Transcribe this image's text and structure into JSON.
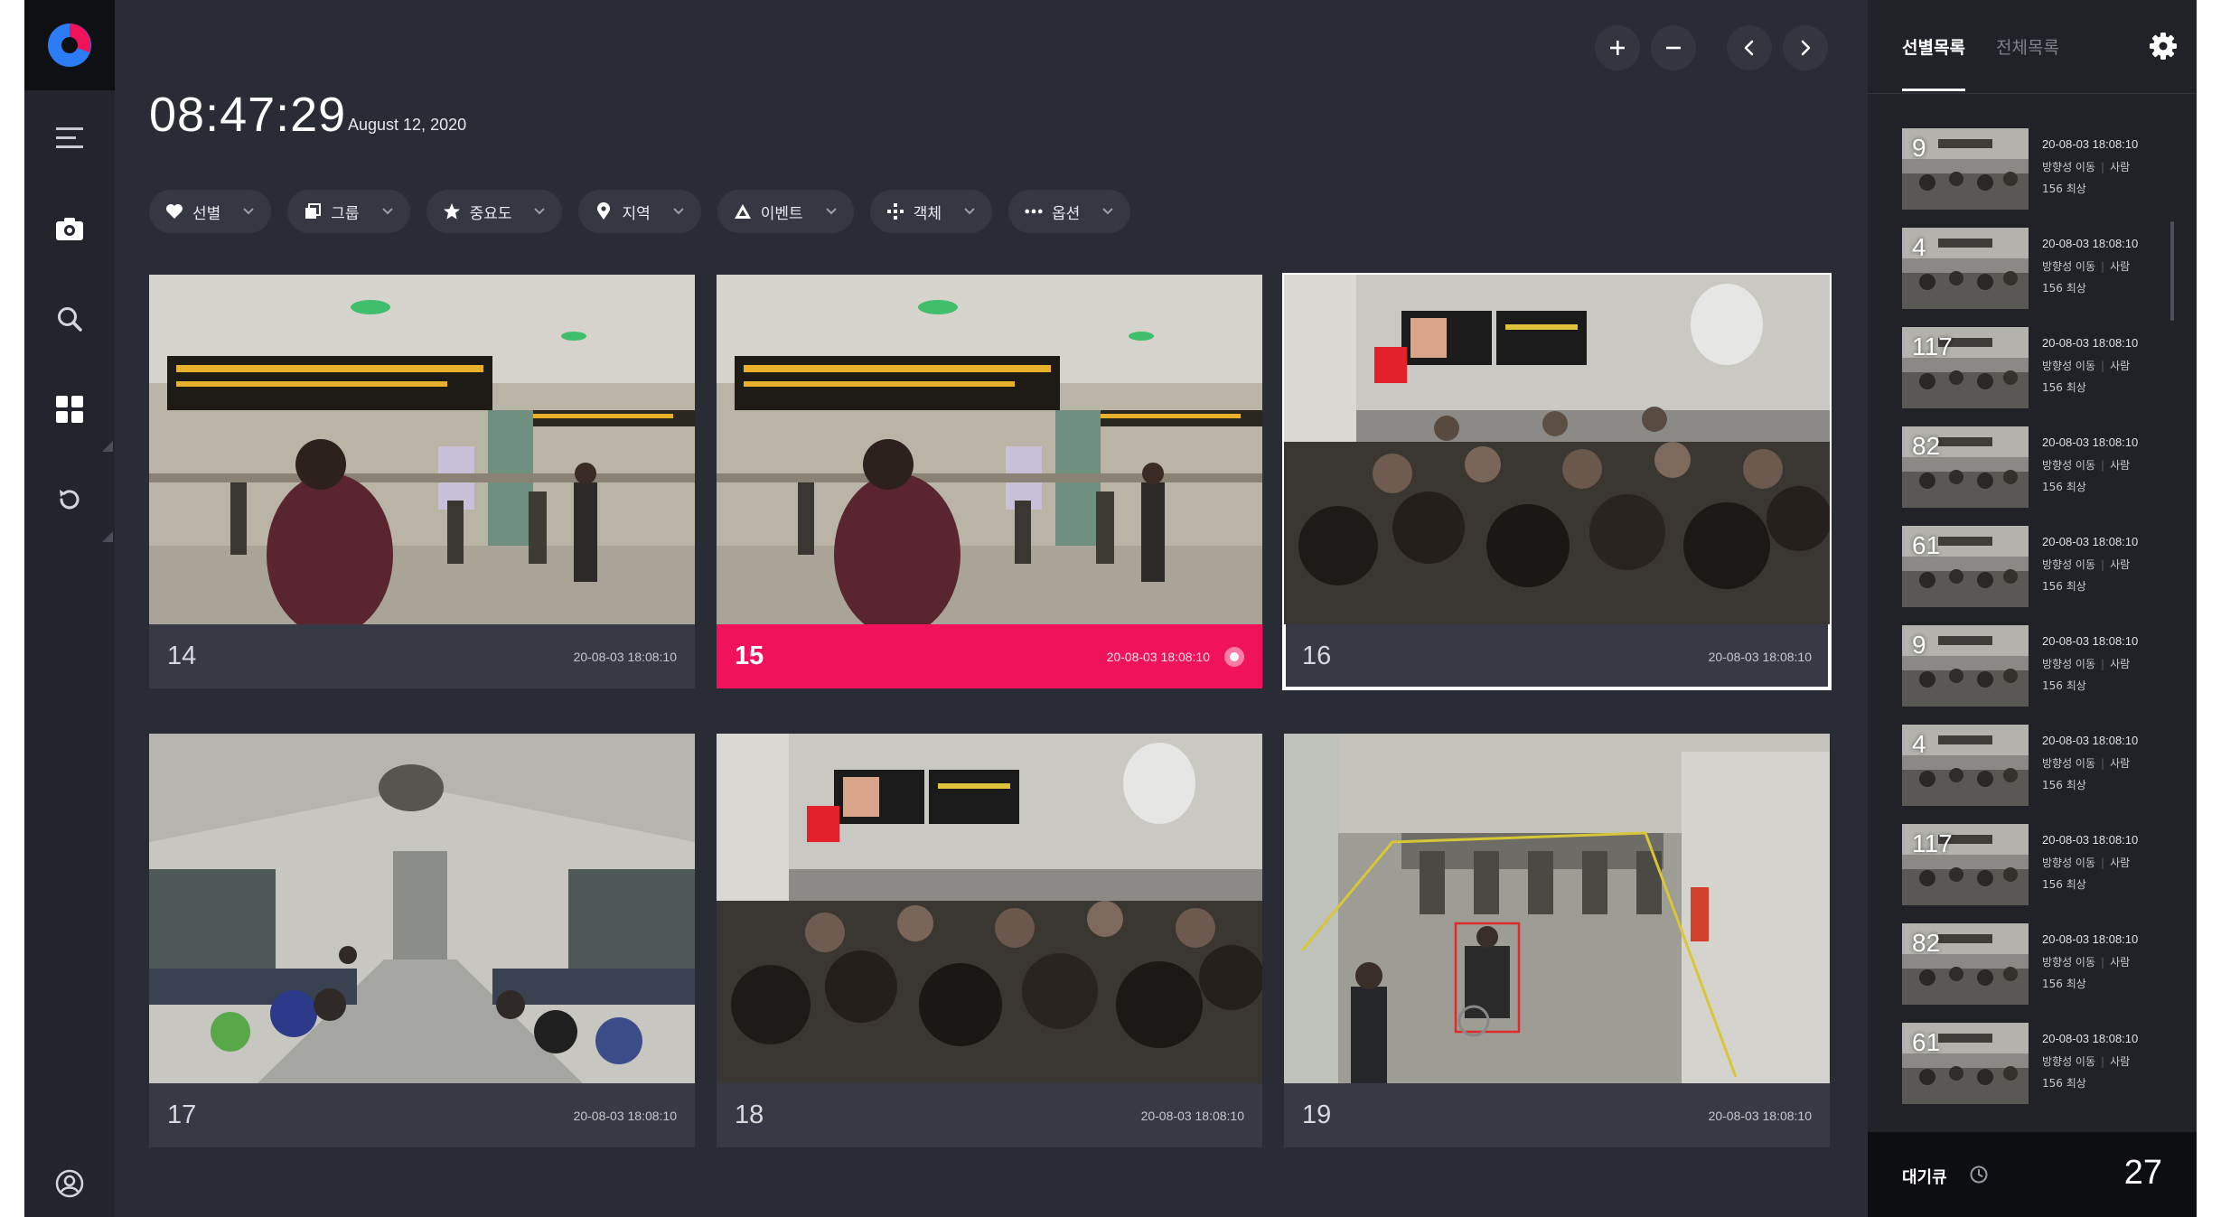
{
  "clock": {
    "time": "08:47:29",
    "date": "August 12, 2020"
  },
  "toolbar": {
    "zoom_in": "plus-icon",
    "zoom_out": "minus-icon",
    "prev": "chevron-left-icon",
    "next": "chevron-right-icon"
  },
  "filters": [
    {
      "label": "선별",
      "icon": "heart-icon"
    },
    {
      "label": "그룹",
      "icon": "stack-icon"
    },
    {
      "label": "중요도",
      "icon": "star-icon"
    },
    {
      "label": "지역",
      "icon": "pin-icon"
    },
    {
      "label": "이벤트",
      "icon": "warning-icon"
    },
    {
      "label": "객체",
      "icon": "object-icon"
    },
    {
      "label": "옵션",
      "icon": "dots-icon"
    }
  ],
  "cameras": [
    {
      "number": "14",
      "timestamp": "20-08-03 18:08:10",
      "state": "normal"
    },
    {
      "number": "15",
      "timestamp": "20-08-03 18:08:10",
      "state": "alert"
    },
    {
      "number": "16",
      "timestamp": "20-08-03 18:08:10",
      "state": "selected"
    },
    {
      "number": "17",
      "timestamp": "20-08-03 18:08:10",
      "state": "normal"
    },
    {
      "number": "18",
      "timestamp": "20-08-03 18:08:10",
      "state": "normal"
    },
    {
      "number": "19",
      "timestamp": "20-08-03 18:08:10",
      "state": "normal"
    }
  ],
  "panel": {
    "tab_selected": "선별목록",
    "tab_all": "전체목록",
    "events": [
      {
        "number": "9",
        "time": "20-08-03 18:08:10",
        "type": "방향성 이동",
        "object": "사람",
        "level": "156 최상"
      },
      {
        "number": "4",
        "time": "20-08-03 18:08:10",
        "type": "방향성 이동",
        "object": "사람",
        "level": "156 최상"
      },
      {
        "number": "117",
        "time": "20-08-03 18:08:10",
        "type": "방향성 이동",
        "object": "사람",
        "level": "156 최상"
      },
      {
        "number": "82",
        "time": "20-08-03 18:08:10",
        "type": "방향성 이동",
        "object": "사람",
        "level": "156 최상"
      },
      {
        "number": "61",
        "time": "20-08-03 18:08:10",
        "type": "방향성 이동",
        "object": "사람",
        "level": "156 최상"
      },
      {
        "number": "9",
        "time": "20-08-03 18:08:10",
        "type": "방향성 이동",
        "object": "사람",
        "level": "156 최상"
      },
      {
        "number": "4",
        "time": "20-08-03 18:08:10",
        "type": "방향성 이동",
        "object": "사람",
        "level": "156 최상"
      },
      {
        "number": "117",
        "time": "20-08-03 18:08:10",
        "type": "방향성 이동",
        "object": "사람",
        "level": "156 최상"
      },
      {
        "number": "82",
        "time": "20-08-03 18:08:10",
        "type": "방향성 이동",
        "object": "사람",
        "level": "156 최상"
      },
      {
        "number": "61",
        "time": "20-08-03 18:08:10",
        "type": "방향성 이동",
        "object": "사람",
        "level": "156 최상"
      }
    ],
    "queue_label": "대기큐",
    "queue_count": "27"
  },
  "colors": {
    "alert": "#f0135b",
    "background": "#2a2c35",
    "panel": "#202228",
    "rail": "#23252d"
  }
}
